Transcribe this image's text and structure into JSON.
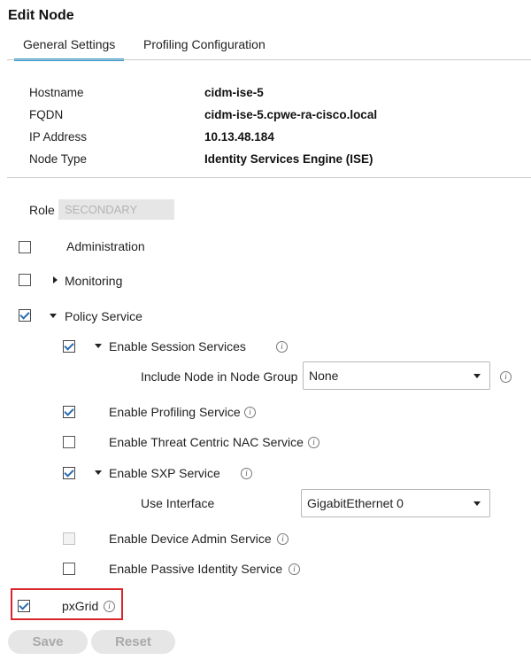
{
  "header": {
    "title": "Edit Node"
  },
  "tabs": [
    {
      "label": "General Settings",
      "active": true
    },
    {
      "label": "Profiling Configuration",
      "active": false
    }
  ],
  "node_info": [
    {
      "label": "Hostname",
      "value": "cidm-ise-5"
    },
    {
      "label": "FQDN",
      "value": "cidm-ise-5.cpwe-ra-cisco.local"
    },
    {
      "label": "IP Address",
      "value": "10.13.48.184"
    },
    {
      "label": "Node Type",
      "value": "Identity Services Engine (ISE)"
    }
  ],
  "role": {
    "label": "Role",
    "value": "SECONDARY"
  },
  "personas": {
    "administration": {
      "label": "Administration",
      "checked": false
    },
    "monitoring": {
      "label": "Monitoring",
      "checked": false,
      "expanded": false
    },
    "policy_service": {
      "label": "Policy Service",
      "checked": true,
      "expanded": true
    },
    "session_services": {
      "label": "Enable Session Services",
      "checked": true,
      "expanded": true
    },
    "node_group": {
      "label": "Include Node in Node Group",
      "value": "None"
    },
    "profiling": {
      "label": "Enable Profiling Service",
      "checked": true
    },
    "threat_centric": {
      "label": "Enable Threat Centric NAC Service",
      "checked": false
    },
    "sxp": {
      "label": "Enable SXP Service",
      "checked": true,
      "expanded": true
    },
    "use_interface": {
      "label": "Use Interface",
      "value": "GigabitEthernet 0"
    },
    "device_admin": {
      "label": "Enable Device Admin Service",
      "checked": false,
      "disabled": true
    },
    "passive_identity": {
      "label": "Enable Passive Identity Service",
      "checked": false
    },
    "pxgrid": {
      "label": "pxGrid",
      "checked": true
    }
  },
  "info_glyph": "i",
  "buttons": {
    "save": "Save",
    "reset": "Reset"
  },
  "colors": {
    "accent": "#2a97d2",
    "highlight": "#d9262b"
  }
}
